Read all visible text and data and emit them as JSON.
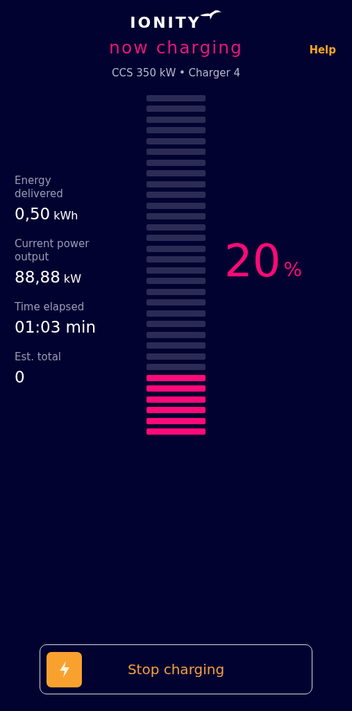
{
  "header": {
    "logo": "IONITY",
    "title": "now charging",
    "help": "Help",
    "subtitle": "CCS 350 kW • Charger 4"
  },
  "stats": [
    {
      "label": "Energy delivered",
      "value": "0,50",
      "unit": "kWh"
    },
    {
      "label": "Current power output",
      "value": "88,88",
      "unit": "kW"
    },
    {
      "label": "Time elapsed",
      "value": "01:03 min"
    },
    {
      "label": "Est. total",
      "value": "0"
    }
  ],
  "battery": {
    "level": 0.2,
    "percent": "20",
    "unit": "%"
  },
  "button": {
    "label": "Stop charging"
  }
}
